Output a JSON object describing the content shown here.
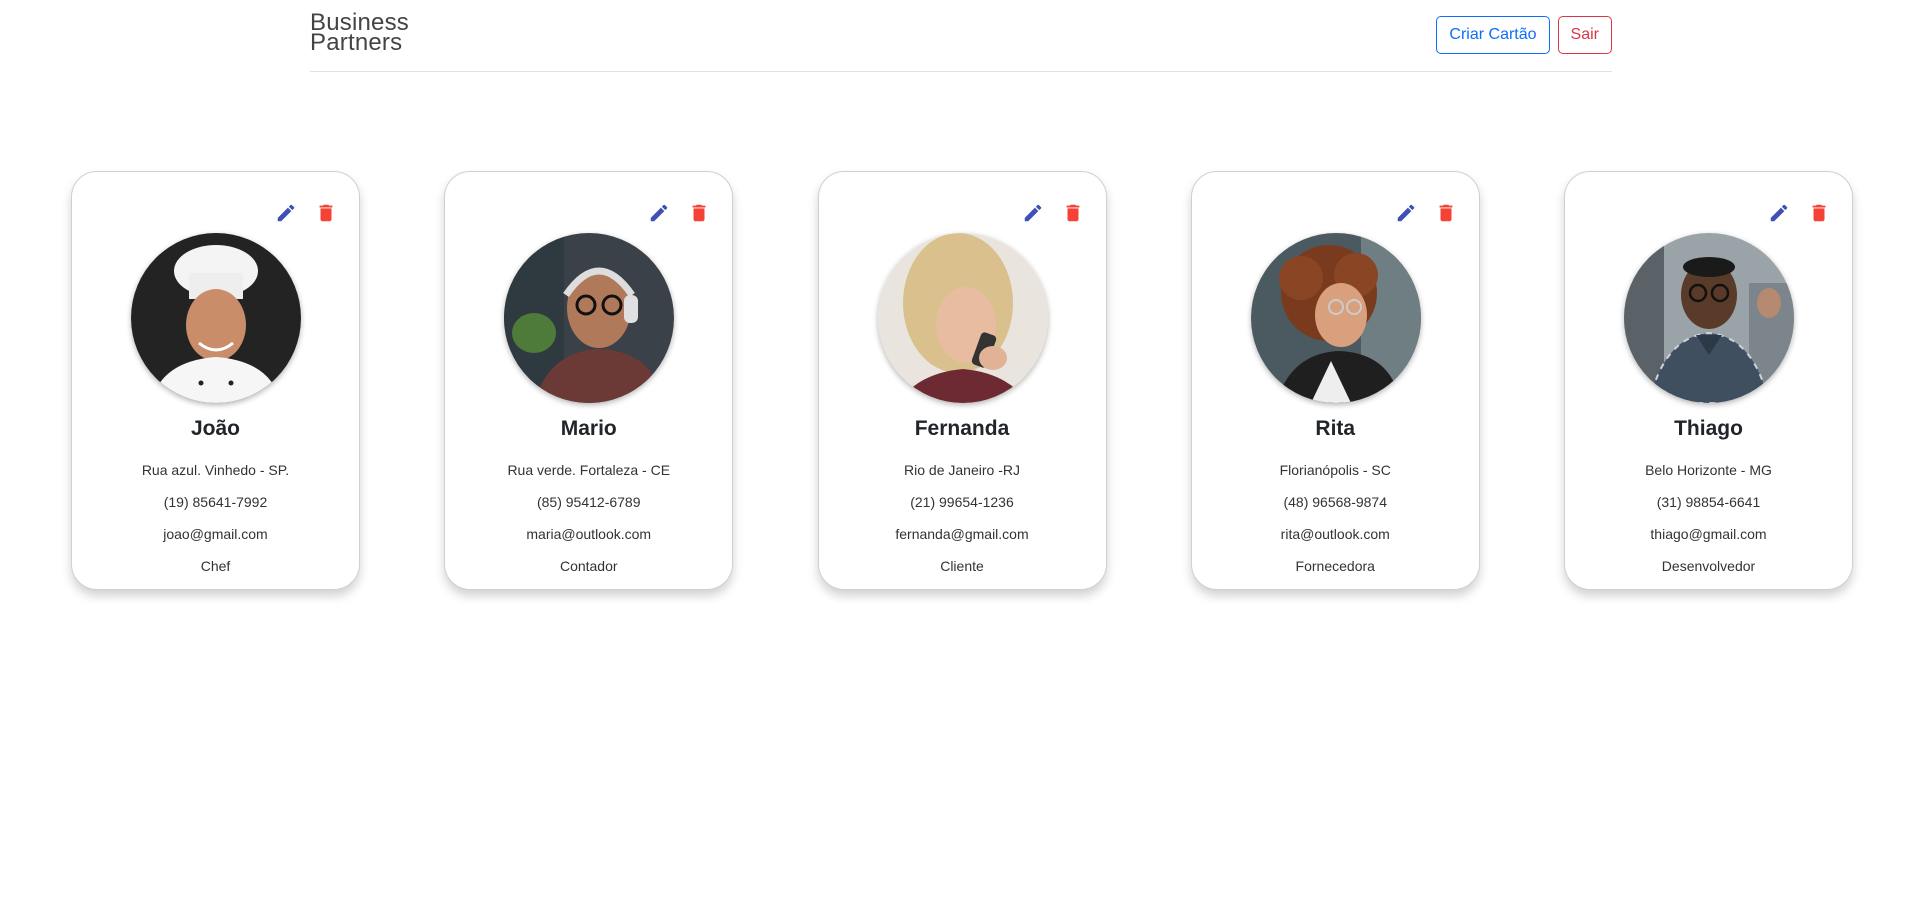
{
  "header": {
    "brand_line1": "Business",
    "brand_line2": "Partners",
    "create_card_label": "Criar Cartão",
    "logout_label": "Sair"
  },
  "icons": {
    "edit": "pencil-icon",
    "delete": "trash-icon",
    "edit_color": "#3f51b5",
    "delete_color": "#f44336"
  },
  "cards": [
    {
      "name": "João",
      "address": "Rua azul. Vinhedo - SP.",
      "phone": "(19) 85641-7992",
      "email": "joao@gmail.com",
      "role": "Chef",
      "photo": "chef-photo"
    },
    {
      "name": "Mario",
      "address": "Rua verde. Fortaleza - CE",
      "phone": "(85) 95412-6789",
      "email": "maria@outlook.com",
      "role": "Contador",
      "photo": "man-headset-photo"
    },
    {
      "name": "Fernanda",
      "address": "Rio de Janeiro -RJ",
      "phone": "(21) 99654-1236",
      "email": "fernanda@gmail.com",
      "role": "Cliente",
      "photo": "woman-phone-photo"
    },
    {
      "name": "Rita",
      "address": "Florianópolis - SC",
      "phone": "(48) 96568-9874",
      "email": "rita@outlook.com",
      "role": "Fornecedora",
      "photo": "woman-curly-phone-photo"
    },
    {
      "name": "Thiago",
      "address": "Belo Horizonte - MG",
      "phone": "(31) 98854-6641",
      "email": "thiago@gmail.com",
      "role": "Desenvolvedor",
      "photo": "man-office-photo"
    }
  ]
}
